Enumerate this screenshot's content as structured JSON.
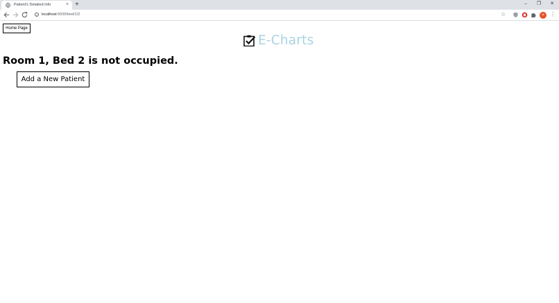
{
  "browser": {
    "tab_title": "Patient's Detailed Info",
    "tab_close": "×",
    "new_tab": "+",
    "url_host": "localhost",
    "url_path": ":5000/bed/1/2",
    "window_controls": {
      "minimize": "–",
      "restore": "❐",
      "close": "✕"
    },
    "star": "☆",
    "menu": "⋮",
    "profile_color": "#e8532b",
    "icons": [
      "back-arrow-icon",
      "forward-arrow-icon",
      "reload-icon",
      "info-icon",
      "bookmark-star-icon",
      "extension-shield-icon",
      "extension-red-icon",
      "extensions-puzzle-icon",
      "profile-avatar-icon",
      "menu-icon"
    ]
  },
  "page": {
    "home_button": "Home Page",
    "brand_name": "E-Charts",
    "brand_color": "#a8d3e3",
    "heading": "Room 1, Bed 2 is not occupied.",
    "add_button": "Add a New Patient"
  }
}
